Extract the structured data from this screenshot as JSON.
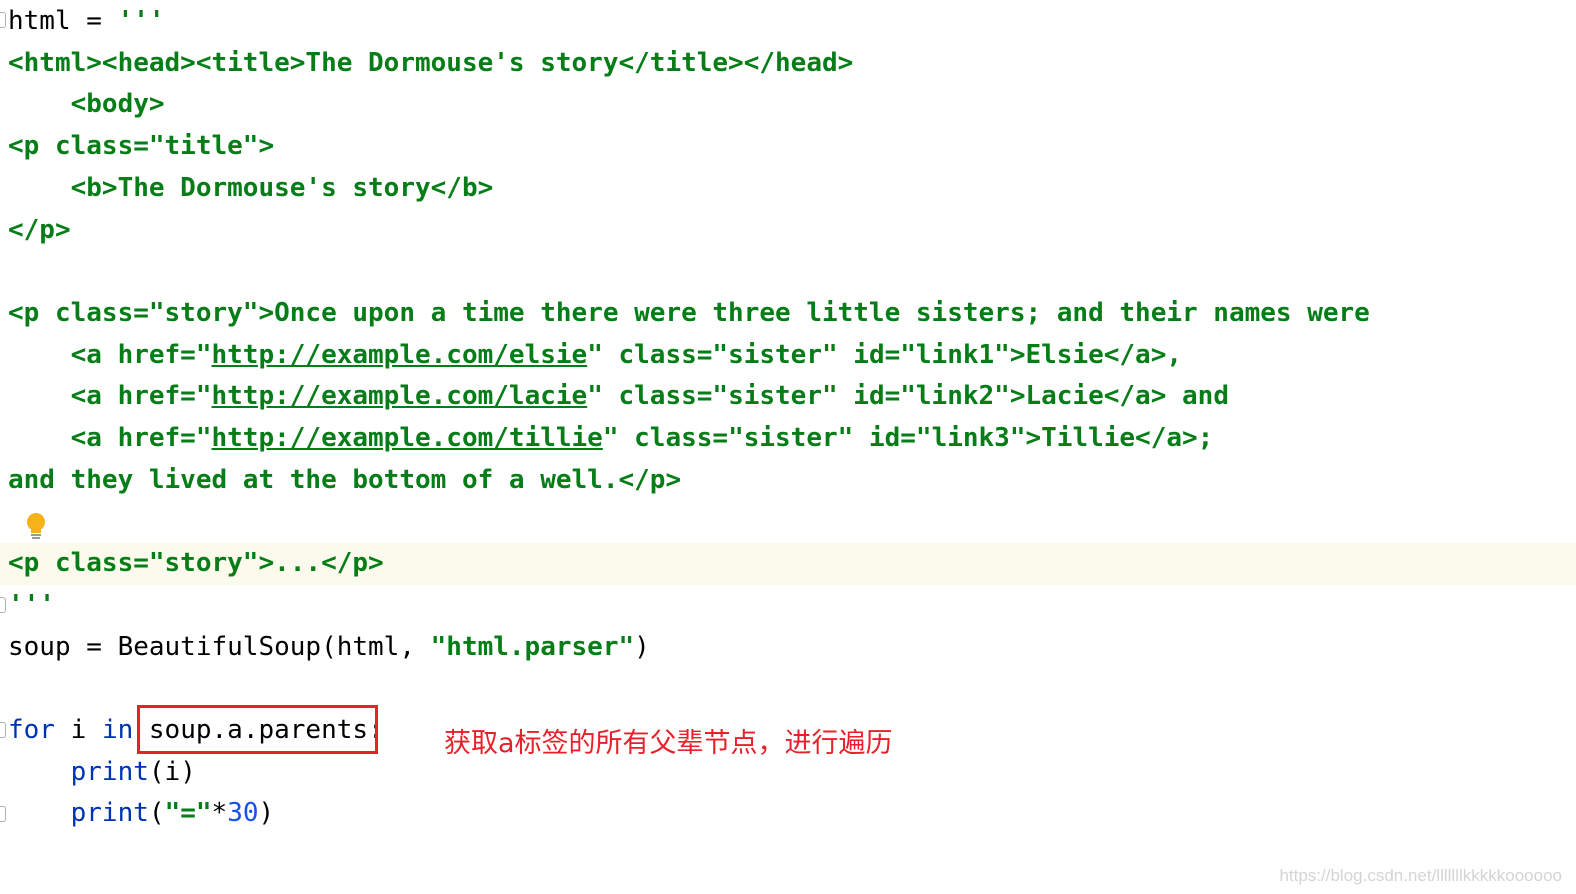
{
  "editor": {
    "language": "python",
    "highlighted_line_color": "#fcfaed",
    "string_color": "#067d17",
    "keyword_color": "#0033b3",
    "number_color": "#1750eb",
    "lines": [
      {
        "segments": [
          {
            "t": "html = ",
            "c": "plain"
          },
          {
            "t": "'''",
            "c": "str"
          }
        ]
      },
      {
        "segments": [
          {
            "t": "<html><head><title>The Dormouse's story</title></head>",
            "c": "str"
          }
        ]
      },
      {
        "segments": [
          {
            "t": "    <body>",
            "c": "str"
          }
        ]
      },
      {
        "segments": [
          {
            "t": "<p class=\"title\">",
            "c": "str"
          }
        ]
      },
      {
        "segments": [
          {
            "t": "    <b>The Dormouse's story</b>",
            "c": "str"
          }
        ]
      },
      {
        "segments": [
          {
            "t": "</p>",
            "c": "str"
          }
        ]
      },
      {
        "segments": []
      },
      {
        "segments": [
          {
            "t": "<p class=\"story\">Once upon a time there were three little sisters; and their names were",
            "c": "str"
          }
        ]
      },
      {
        "segments": [
          {
            "t": "    <a href=\"",
            "c": "str"
          },
          {
            "t": "http://example.com/elsie",
            "c": "str url"
          },
          {
            "t": "\" class=\"sister\" id=\"link1\">Elsie</a>,",
            "c": "str"
          }
        ]
      },
      {
        "segments": [
          {
            "t": "    <a href=\"",
            "c": "str"
          },
          {
            "t": "http://example.com/lacie",
            "c": "str url"
          },
          {
            "t": "\" class=\"sister\" id=\"link2\">Lacie</a> and",
            "c": "str"
          }
        ]
      },
      {
        "segments": [
          {
            "t": "    <a href=\"",
            "c": "str"
          },
          {
            "t": "http://example.com/tillie",
            "c": "str url"
          },
          {
            "t": "\" class=\"sister\" id=\"link3\">Tillie</a>;",
            "c": "str"
          }
        ]
      },
      {
        "segments": [
          {
            "t": "and they lived at the bottom of a well.</p>",
            "c": "str"
          }
        ]
      },
      {
        "segments": []
      },
      {
        "segments": [
          {
            "t": "<p class=\"story\">...</p>",
            "c": "str"
          }
        ]
      },
      {
        "segments": [
          {
            "t": "'''",
            "c": "str"
          }
        ]
      },
      {
        "segments": [
          {
            "t": "soup = BeautifulSoup(html, ",
            "c": "plain"
          },
          {
            "t": "\"html.parser\"",
            "c": "str"
          },
          {
            "t": ")",
            "c": "plain"
          }
        ]
      },
      {
        "segments": []
      },
      {
        "segments": [
          {
            "t": "for",
            "c": "kw"
          },
          {
            "t": " i ",
            "c": "plain"
          },
          {
            "t": "in",
            "c": "kw"
          },
          {
            "t": " soup.a.parents:",
            "c": "plain"
          }
        ]
      },
      {
        "segments": [
          {
            "t": "    ",
            "c": "plain"
          },
          {
            "t": "print",
            "c": "kw"
          },
          {
            "t": "(i)",
            "c": "plain"
          }
        ]
      },
      {
        "segments": [
          {
            "t": "    ",
            "c": "plain"
          },
          {
            "t": "print",
            "c": "kw"
          },
          {
            "t": "(",
            "c": "plain"
          },
          {
            "t": "\"=\"",
            "c": "str"
          },
          {
            "t": "*",
            "c": "plain"
          },
          {
            "t": "30",
            "c": "num"
          },
          {
            "t": ")",
            "c": "plain"
          }
        ]
      }
    ]
  },
  "annotation": {
    "text": "获取a标签的所有父辈节点，进行遍历",
    "color": "#e8202a"
  },
  "icons": {
    "intention": "lightbulb-icon",
    "fold": "fold-marker-icon"
  },
  "watermark": "https://blog.csdn.net/lllllllkkkkkoooooo"
}
